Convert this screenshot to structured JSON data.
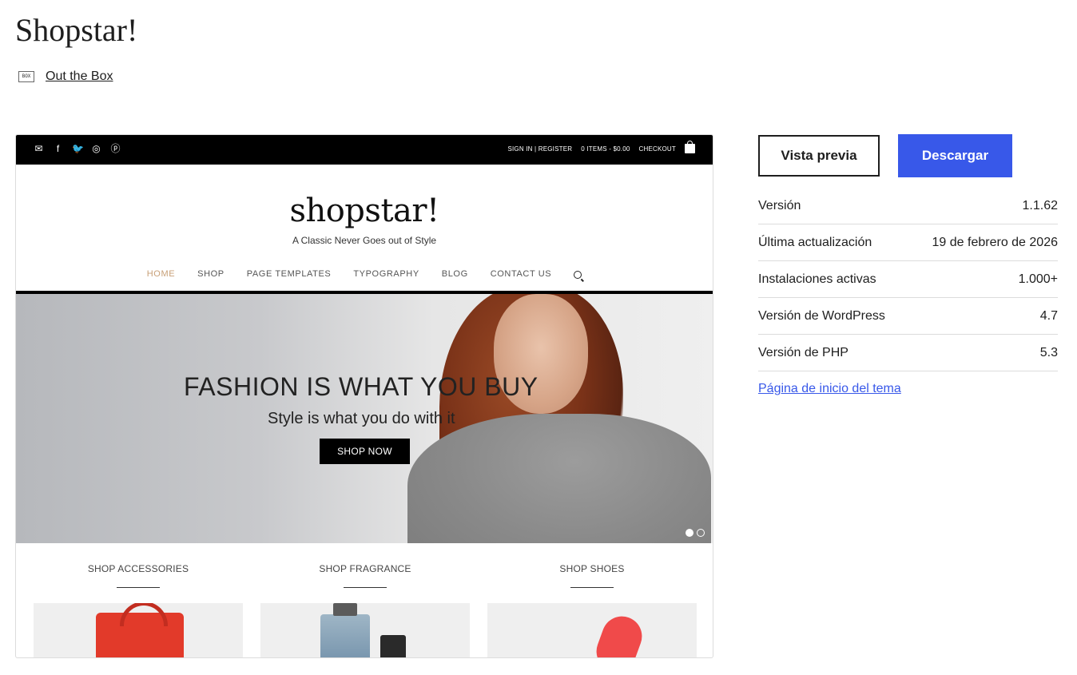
{
  "title": "Shopstar!",
  "author": {
    "logo_text": "BOX",
    "name": "Out the Box"
  },
  "screenshot": {
    "topbar": {
      "social_icons": [
        "envelope-icon",
        "facebook-icon",
        "twitter-icon",
        "instagram-icon",
        "pinterest-icon"
      ],
      "account": "SIGN IN | REGISTER",
      "cart": "0 ITEMS - $0.00",
      "checkout": "CHECKOUT"
    },
    "brand": "shopstar!",
    "tagline": "A Classic Never Goes out of Style",
    "nav": [
      "HOME",
      "SHOP",
      "PAGE TEMPLATES",
      "TYPOGRAPHY",
      "BLOG",
      "CONTACT US"
    ],
    "hero": {
      "headline": "FASHION IS WHAT YOU BUY",
      "subheadline": "Style is what you do with it",
      "button": "SHOP NOW"
    },
    "categories": [
      "SHOP ACCESSORIES",
      "SHOP FRAGRANCE",
      "SHOP SHOES"
    ]
  },
  "actions": {
    "preview": "Vista previa",
    "download": "Descargar"
  },
  "meta": [
    {
      "label": "Versión",
      "value": "1.1.62"
    },
    {
      "label": "Última actualización",
      "value": "19 de febrero de 2026"
    },
    {
      "label": "Instalaciones activas",
      "value": "1.000+"
    },
    {
      "label": "Versión de WordPress",
      "value": "4.7"
    },
    {
      "label": "Versión de PHP",
      "value": "5.3"
    }
  ],
  "homepage_link": "Página de inicio del tema",
  "colors": {
    "accent": "#3858e9",
    "text": "#1e1e1e",
    "nav_active": "#c8a078"
  }
}
